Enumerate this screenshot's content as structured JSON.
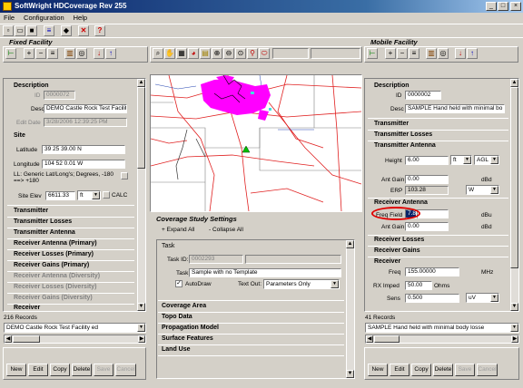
{
  "app": {
    "title": "SoftWright HDCoverage Rev 255"
  },
  "menu": [
    "File",
    "Configuration",
    "Help"
  ],
  "fixed": {
    "panel_title": "Fixed Facility",
    "description_title": "Description",
    "id_label": "ID",
    "id_value": "0000072",
    "desc_label": "Desc",
    "desc_value": "DEMO Castle Rock Test Facilit",
    "edit_date_label": "Edit Date",
    "edit_date_value": "3/28/2006 12:39:25 PM",
    "site_title": "Site",
    "latitude_label": "Latitude",
    "latitude_value": "39 25 39.00 N",
    "longitude_label": "Longitude",
    "longitude_value": "104 52 0.01 W",
    "ll_note": "LL: Generic Lat/Long's; Degrees, -180 ==> +180",
    "site_elev_label": "Site Elev",
    "site_elev_value": "6611.33",
    "site_elev_unit": "ft",
    "calc_label": "CALC",
    "sections": [
      {
        "label": "Transmitter",
        "disabled": false
      },
      {
        "label": "Transmitter Losses",
        "disabled": false
      },
      {
        "label": "Transmitter Antenna",
        "disabled": false
      },
      {
        "label": "Receiver Antenna (Primary)",
        "disabled": false
      },
      {
        "label": "Receiver Losses (Primary)",
        "disabled": false
      },
      {
        "label": "Receiver Gains (Primary)",
        "disabled": false
      },
      {
        "label": "Receiver Antenna (Diversity)",
        "disabled": true
      },
      {
        "label": "Receiver Losses (Diversity)",
        "disabled": true
      },
      {
        "label": "Receiver Gains (Diversity)",
        "disabled": true
      },
      {
        "label": "Receiver",
        "disabled": false
      }
    ],
    "records": "216 Records",
    "selected": "DEMO Castle Rock Test Facility ed",
    "buttons": [
      "New",
      "Edit",
      "Copy",
      "Delete",
      "Save",
      "Cancel"
    ]
  },
  "coverage": {
    "title": "Coverage Study Settings",
    "expand": "+ Expand All",
    "collapse": "- Collapse All",
    "task_title": "Task",
    "task_id_label": "Task ID:",
    "task_id_value": "0002293",
    "task_label": "Task",
    "task_value": "Sample with no Template",
    "autodraw_label": "AutoDraw",
    "textout_label": "Text Out:",
    "textout_value": "Parameters Only",
    "sections": [
      "Coverage Area",
      "Topo Data",
      "Propagation Model",
      "Surface Features",
      "Land Use"
    ]
  },
  "mobile": {
    "panel_title": "Mobile Facility",
    "description_title": "Description",
    "id_label": "ID",
    "id_value": "0000002",
    "desc_label": "Desc",
    "desc_value": "SAMPLE Hand held with minimal bo",
    "sections_top": [
      "Transmitter",
      "Transmitter Losses"
    ],
    "tx_antenna_title": "Transmitter Antenna",
    "height_label": "Height",
    "height_value": "6.00",
    "height_unit": "ft",
    "height_ref": "AGL",
    "ant_gain_label": "Ant Gain",
    "ant_gain_value": "0.00",
    "ant_gain_unit": "dBd",
    "erp_label": "ERP",
    "erp_value": "103.28",
    "erp_unit": "W",
    "rx_antenna_title": "Receiver Antenna",
    "freq_field_label": "Freq Field",
    "freq_field_value": "7.84",
    "freq_field_unit": "dBu",
    "rx_ant_gain_label": "Ant Gain",
    "rx_ant_gain_value": "0.00",
    "rx_ant_gain_unit": "dBd",
    "sections_mid": [
      "Receiver Losses",
      "Receiver Gains"
    ],
    "receiver_title": "Receiver",
    "freq_label": "Freq",
    "freq_value": "155.00000",
    "freq_unit": "MHz",
    "rx_imped_label": "RX Imped",
    "rx_imped_value": "50.00",
    "rx_imped_unit": "Ohms",
    "sens_label": "Sens",
    "sens_value": "0.500",
    "sens_unit": "uV",
    "records": "41 Records",
    "selected": "SAMPLE Hand held with minimal body losse",
    "buttons": [
      "New",
      "Edit",
      "Copy",
      "Delete",
      "Save",
      "Cancel"
    ]
  },
  "colors": {
    "accent_title": "#0a246a",
    "coverage_fill": "#ff00ff",
    "highlight_circle": "#e00000"
  }
}
